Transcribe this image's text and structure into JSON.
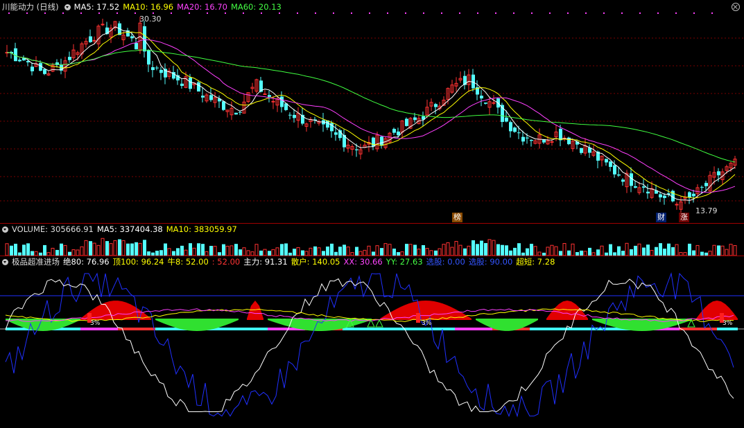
{
  "main": {
    "title": "川能动力 (日线)",
    "ma": [
      {
        "label": "MA5: 17.52",
        "color": "#ffffff"
      },
      {
        "label": "MA10: 16.96",
        "color": "#ffff00"
      },
      {
        "label": "MA20: 16.70",
        "color": "#ff40ff"
      },
      {
        "label": "MA60: 20.13",
        "color": "#40ff40"
      }
    ],
    "high_label": "30.30",
    "low_label": "13.79",
    "markers": {
      "bang": "榜",
      "cai": "财",
      "zhang": "涨"
    }
  },
  "volume": {
    "items": [
      {
        "label": "VOLUME: 305666.91",
        "color": "#dddddd"
      },
      {
        "label": "MA5: 337404.38",
        "color": "#ffffff"
      },
      {
        "label": "MA10: 383059.97",
        "color": "#ffff00"
      }
    ]
  },
  "indicator": {
    "items": [
      {
        "label": "极品超准进场",
        "color": "#dddddd"
      },
      {
        "label": "绝80: 76.96",
        "color": "#ffffff"
      },
      {
        "label": "顶100: 96.24",
        "color": "#ffff00"
      },
      {
        "label": "牛8: 52.00",
        "color": "#ffff00"
      },
      {
        "label": ": 52.00",
        "color": "#ff3030"
      },
      {
        "label": "主力: 91.31",
        "color": "#ffffff"
      },
      {
        "label": "散户: 140.05",
        "color": "#ffff00"
      },
      {
        "label": "XX: 30.66",
        "color": "#ff40ff"
      },
      {
        "label": "YY: 27.63",
        "color": "#40ff40"
      },
      {
        "label": "选股: 0.00",
        "color": "#3050ff"
      },
      {
        "label": "选股: 90.00",
        "color": "#3050ff"
      },
      {
        "label": "超短: 7.28",
        "color": "#ffff00"
      }
    ],
    "pct_labels": [
      "3%",
      "3%",
      "3%"
    ]
  },
  "chart_data": {
    "type": "candlestick",
    "y_range": [
      13.79,
      30.3
    ],
    "ma_periods": [
      5,
      10,
      20,
      60
    ],
    "trend_closes": [
      27.5,
      26.8,
      25.6,
      26.3,
      27.9,
      29.2,
      29.8,
      28.6,
      26.4,
      25.6,
      24.9,
      23.8,
      22.9,
      22.4,
      24.6,
      23.2,
      22.1,
      21.3,
      20.4,
      19.6,
      18.9,
      19.7,
      20.6,
      21.4,
      22.7,
      24.3,
      25.1,
      23.4,
      21.5,
      20.1,
      19.8,
      20.3,
      19.5,
      18.4,
      17.1,
      16.2,
      15.6,
      14.5,
      13.9,
      15.1,
      16.6,
      17.5
    ],
    "indicator_range": [
      0,
      100
    ]
  }
}
